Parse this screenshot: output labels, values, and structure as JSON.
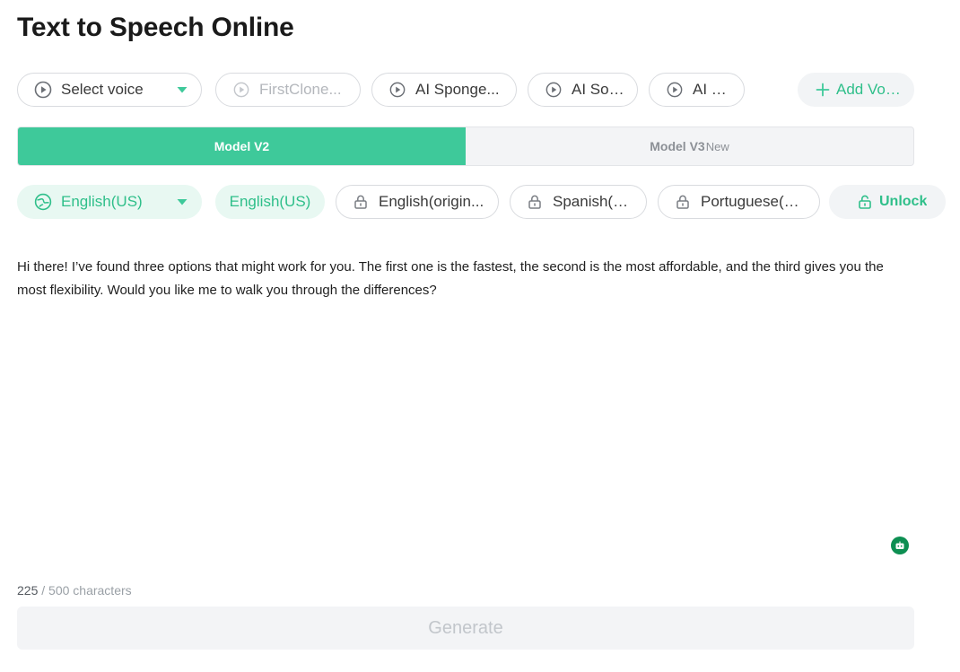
{
  "page": {
    "title": "Text to Speech Online"
  },
  "voices": {
    "select_label": "Select voice",
    "items": [
      {
        "label": "FirstClone...",
        "disabled": true
      },
      {
        "label": "AI Sponge..."
      },
      {
        "label": "AI Sonic"
      },
      {
        "label": "AI Dio"
      }
    ],
    "add_label": "Add Voice"
  },
  "models": {
    "v2_label": "Model V2",
    "v3_label": "Model V3",
    "v3_badge": "New"
  },
  "languages": {
    "selected": "English(US)",
    "items": [
      {
        "label": "English(US)",
        "active": true
      },
      {
        "label": "English(origin...",
        "locked": true
      },
      {
        "label": "Spanish(ES)",
        "locked": true
      },
      {
        "label": "Portuguese(PT)",
        "locked": true
      }
    ],
    "unlock_label": "Unlock"
  },
  "editor": {
    "text": "Hi there! I’ve found three options that might work for you. The first one is the fastest, the second is the most affordable, and the third gives you the most flexibility. Would you like me to walk you through the differences?",
    "char_count": "225",
    "char_limit": "500",
    "char_suffix": "characters"
  },
  "generate": {
    "label": "Generate"
  },
  "colors": {
    "accent": "#3ec99a",
    "accent_text": "#2fbf8a",
    "accent_light": "#e8f8f2",
    "disabled_bg": "#f3f4f6",
    "bot": "#0d8f52"
  },
  "icons": {
    "play": "play-circle-icon",
    "caret": "caret-down-icon",
    "plus": "plus-icon",
    "lock": "lock-icon",
    "language": "language-icon",
    "unlock": "unlock-icon",
    "bot": "robot-icon"
  }
}
